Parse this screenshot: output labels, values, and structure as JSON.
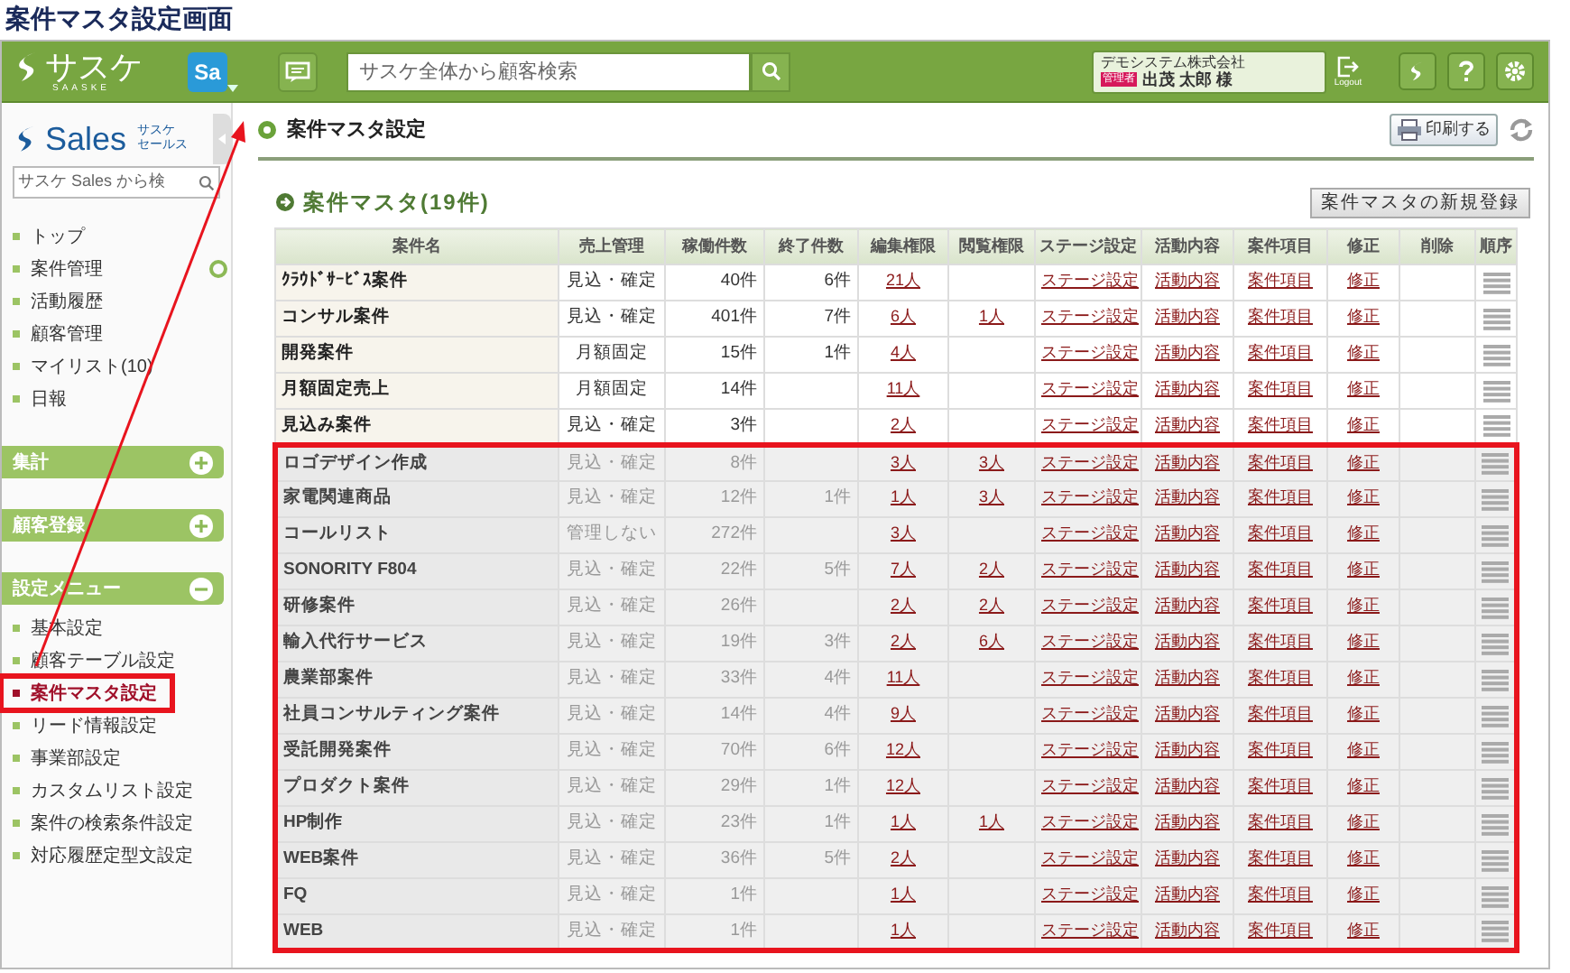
{
  "page_title": "案件マスタ設定画面",
  "header": {
    "logo": "サスケ",
    "logo_sub": "SAASKE",
    "app_badge": "Sa",
    "search_placeholder": "サスケ全体から顧客検索",
    "company": "デモシステム株式会社",
    "role_badge": "管理者",
    "user": "出茂 太郎 様",
    "logout": "Logout"
  },
  "sidebar": {
    "logo": "Sales",
    "logo_sub_1": "サスケ",
    "logo_sub_2": "セールス",
    "search_placeholder": "サスケ Sales から検",
    "items": [
      {
        "label": "トップ",
        "expandable": false
      },
      {
        "label": "案件管理",
        "expandable": true
      },
      {
        "label": "活動履歴",
        "expandable": false
      },
      {
        "label": "顧客管理",
        "expandable": false
      },
      {
        "label": "マイリスト(10)",
        "expandable": false
      },
      {
        "label": "日報",
        "expandable": false
      }
    ],
    "sections": [
      {
        "label": "集計",
        "expanded": false
      },
      {
        "label": "顧客登録",
        "expanded": false
      },
      {
        "label": "設定メニュー",
        "expanded": true,
        "items": [
          {
            "label": "基本設定",
            "selected": false,
            "marked": false
          },
          {
            "label": "顧客テーブル設定",
            "selected": false,
            "marked": false
          },
          {
            "label": "案件マスタ設定",
            "selected": true,
            "marked": true
          },
          {
            "label": "リード情報設定",
            "selected": false,
            "marked": false
          },
          {
            "label": "事業部設定",
            "selected": false,
            "marked": false
          },
          {
            "label": "カスタムリスト設定",
            "selected": false,
            "marked": false
          },
          {
            "label": "案件の検索条件設定",
            "selected": false,
            "marked": false
          },
          {
            "label": "対応履歴定型文設定",
            "selected": false,
            "marked": false
          }
        ]
      }
    ]
  },
  "main": {
    "title": "案件マスタ設定",
    "print_button": "印刷する",
    "list_title": "案件マスタ(19件)",
    "new_button": "案件マスタの新規登録",
    "table": {
      "columns": [
        "案件名",
        "売上管理",
        "稼働件数",
        "終了件数",
        "編集権限",
        "閲覧権限",
        "ステージ設定",
        "活動内容",
        "案件項目",
        "修正",
        "削除",
        "順序"
      ],
      "rows": [
        {
          "name": "ｸﾗｳﾄﾞｻｰﾋﾞｽ案件",
          "sales": "見込・確定",
          "active": "40件",
          "closed": "6件",
          "edit": "21人",
          "view": "",
          "stage": "ステージ設定",
          "activity": "活動内容",
          "fields": "案件項目",
          "modify": "修正",
          "disabled": false,
          "marked": false
        },
        {
          "name": "コンサル案件",
          "sales": "見込・確定",
          "active": "401件",
          "closed": "7件",
          "edit": "6人",
          "view": "1人",
          "stage": "ステージ設定",
          "activity": "活動内容",
          "fields": "案件項目",
          "modify": "修正",
          "disabled": false,
          "marked": false
        },
        {
          "name": "開発案件",
          "sales": "月額固定",
          "active": "15件",
          "closed": "1件",
          "edit": "4人",
          "view": "",
          "stage": "ステージ設定",
          "activity": "活動内容",
          "fields": "案件項目",
          "modify": "修正",
          "disabled": false,
          "marked": false
        },
        {
          "name": "月額固定売上",
          "sales": "月額固定",
          "active": "14件",
          "closed": "",
          "edit": "11人",
          "view": "",
          "stage": "ステージ設定",
          "activity": "活動内容",
          "fields": "案件項目",
          "modify": "修正",
          "disabled": false,
          "marked": false
        },
        {
          "name": "見込み案件",
          "sales": "見込・確定",
          "active": "3件",
          "closed": "",
          "edit": "2人",
          "view": "",
          "stage": "ステージ設定",
          "activity": "活動内容",
          "fields": "案件項目",
          "modify": "修正",
          "disabled": false,
          "marked": false
        },
        {
          "name": "ロゴデザイン作成",
          "sales": "見込・確定",
          "active": "8件",
          "closed": "",
          "edit": "3人",
          "view": "3人",
          "stage": "ステージ設定",
          "activity": "活動内容",
          "fields": "案件項目",
          "modify": "修正",
          "disabled": true,
          "marked": true
        },
        {
          "name": "家電関連商品",
          "sales": "見込・確定",
          "active": "12件",
          "closed": "1件",
          "edit": "1人",
          "view": "3人",
          "stage": "ステージ設定",
          "activity": "活動内容",
          "fields": "案件項目",
          "modify": "修正",
          "disabled": true,
          "marked": true
        },
        {
          "name": "コールリスト",
          "sales": "管理しない",
          "active": "272件",
          "closed": "",
          "edit": "3人",
          "view": "",
          "stage": "ステージ設定",
          "activity": "活動内容",
          "fields": "案件項目",
          "modify": "修正",
          "disabled": true,
          "marked": true
        },
        {
          "name": "SONORITY F804",
          "sales": "見込・確定",
          "active": "22件",
          "closed": "5件",
          "edit": "7人",
          "view": "2人",
          "stage": "ステージ設定",
          "activity": "活動内容",
          "fields": "案件項目",
          "modify": "修正",
          "disabled": true,
          "marked": true
        },
        {
          "name": "研修案件",
          "sales": "見込・確定",
          "active": "26件",
          "closed": "",
          "edit": "2人",
          "view": "2人",
          "stage": "ステージ設定",
          "activity": "活動内容",
          "fields": "案件項目",
          "modify": "修正",
          "disabled": true,
          "marked": true
        },
        {
          "name": "輸入代行サービス",
          "sales": "見込・確定",
          "active": "19件",
          "closed": "3件",
          "edit": "2人",
          "view": "6人",
          "stage": "ステージ設定",
          "activity": "活動内容",
          "fields": "案件項目",
          "modify": "修正",
          "disabled": true,
          "marked": true
        },
        {
          "name": "農業部案件",
          "sales": "見込・確定",
          "active": "33件",
          "closed": "4件",
          "edit": "11人",
          "view": "",
          "stage": "ステージ設定",
          "activity": "活動内容",
          "fields": "案件項目",
          "modify": "修正",
          "disabled": true,
          "marked": true
        },
        {
          "name": "社員コンサルティング案件",
          "sales": "見込・確定",
          "active": "14件",
          "closed": "4件",
          "edit": "9人",
          "view": "",
          "stage": "ステージ設定",
          "activity": "活動内容",
          "fields": "案件項目",
          "modify": "修正",
          "disabled": true,
          "marked": true
        },
        {
          "name": "受託開発案件",
          "sales": "見込・確定",
          "active": "70件",
          "closed": "6件",
          "edit": "12人",
          "view": "",
          "stage": "ステージ設定",
          "activity": "活動内容",
          "fields": "案件項目",
          "modify": "修正",
          "disabled": true,
          "marked": true
        },
        {
          "name": "プロダクト案件",
          "sales": "見込・確定",
          "active": "29件",
          "closed": "1件",
          "edit": "12人",
          "view": "",
          "stage": "ステージ設定",
          "activity": "活動内容",
          "fields": "案件項目",
          "modify": "修正",
          "disabled": true,
          "marked": true
        },
        {
          "name": "HP制作",
          "sales": "見込・確定",
          "active": "23件",
          "closed": "1件",
          "edit": "1人",
          "view": "1人",
          "stage": "ステージ設定",
          "activity": "活動内容",
          "fields": "案件項目",
          "modify": "修正",
          "disabled": true,
          "marked": true
        },
        {
          "name": "WEB案件",
          "sales": "見込・確定",
          "active": "36件",
          "closed": "5件",
          "edit": "2人",
          "view": "",
          "stage": "ステージ設定",
          "activity": "活動内容",
          "fields": "案件項目",
          "modify": "修正",
          "disabled": true,
          "marked": true
        },
        {
          "name": "FQ",
          "sales": "見込・確定",
          "active": "1件",
          "closed": "",
          "edit": "1人",
          "view": "",
          "stage": "ステージ設定",
          "activity": "活動内容",
          "fields": "案件項目",
          "modify": "修正",
          "disabled": true,
          "marked": true
        },
        {
          "name": "WEB",
          "sales": "見込・確定",
          "active": "1件",
          "closed": "",
          "edit": "1人",
          "view": "",
          "stage": "ステージ設定",
          "activity": "活動内容",
          "fields": "案件項目",
          "modify": "修正",
          "disabled": true,
          "marked": true
        }
      ]
    }
  }
}
